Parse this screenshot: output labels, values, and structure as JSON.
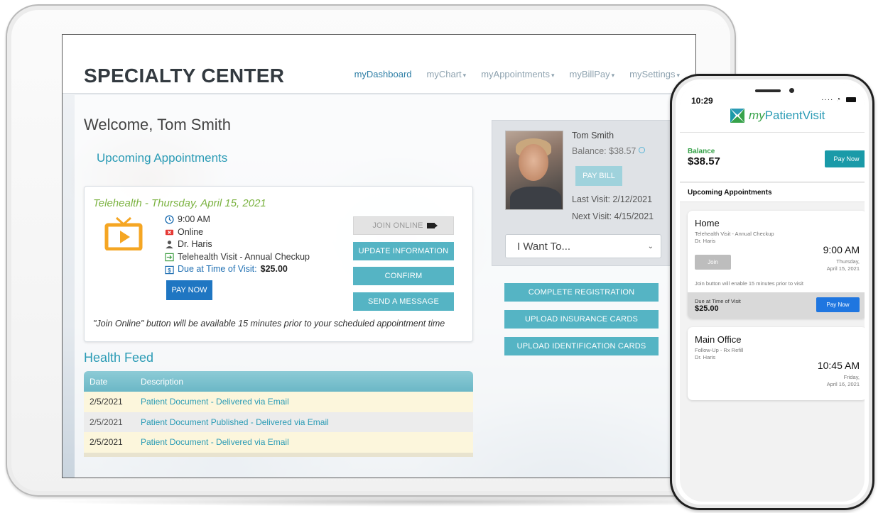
{
  "colors": {
    "accent": "#2a9bb5",
    "green": "#7cb342",
    "button": "#55b4c4",
    "pay_blue": "#1f76c2"
  },
  "site": {
    "title": "SPECIALTY CENTER",
    "nav": [
      {
        "prefix": "my",
        "label": "Dashboard"
      },
      {
        "prefix": "my",
        "label": "Chart"
      },
      {
        "prefix": "my",
        "label": "Appointments"
      },
      {
        "prefix": "my",
        "label": "BillPay"
      },
      {
        "prefix": "my",
        "label": "Settings"
      }
    ],
    "nav_full": [
      "myDashboard",
      "myChart",
      "myAppointments",
      "myBillPay",
      "mySettings"
    ]
  },
  "main": {
    "welcome": "Welcome, Tom Smith",
    "upcoming_title": "Upcoming Appointments",
    "appointment": {
      "heading": "Telehealth - Thursday, April 15, 2021",
      "time": "9:00 AM",
      "mode": "Online",
      "provider": "Dr. Haris",
      "visit_type": "Telehealth Visit - Annual Checkup",
      "due_label": "Due at Time of Visit:",
      "due_amount": "$25.00",
      "pay_now": "PAY NOW",
      "join_online": "JOIN ONLINE",
      "update_info": "UPDATE INFORMATION",
      "confirm": "CONFIRM",
      "send_message": "SEND A MESSAGE",
      "join_note": "\"Join Online\" button will be available 15 minutes prior to your scheduled appointment time",
      "icons": [
        "tv-icon",
        "clock-icon",
        "video-icon",
        "person-icon",
        "visit-arrow-icon",
        "dollar-icon",
        "camera-icon"
      ]
    },
    "health_feed": {
      "title": "Health Feed",
      "columns": [
        "Date",
        "Description"
      ],
      "rows": [
        {
          "date": "2/5/2021",
          "description": "Patient Document - Delivered via Email"
        },
        {
          "date": "2/5/2021",
          "description": "Patient Document Published - Delivered via Email"
        },
        {
          "date": "2/5/2021",
          "description": "Patient Document - Delivered via Email"
        }
      ]
    }
  },
  "profile": {
    "name": "Tom Smith",
    "balance": "Balance: $38.57",
    "pay_bill": "PAY BILL",
    "last_visit": "Last Visit: 2/12/2021",
    "next_visit": "Next Visit: 4/15/2021",
    "want_to": "I Want To..."
  },
  "actions": {
    "complete_registration": "COMPLETE REGISTRATION",
    "upload_insurance": "UPLOAD INSURANCE CARDS",
    "upload_identification": "UPLOAD IDENTIFICATION CARDS"
  },
  "phone": {
    "status_time": "10:29",
    "brand_prefix": "my",
    "brand_suffix": "PatientVisit",
    "balance_label": "Balance",
    "balance_value": "$38.57",
    "pay_now": "Pay Now",
    "upcoming": "Upcoming Appointments",
    "cards": [
      {
        "location": "Home",
        "subtitle": "Telehealth Visit - Annual Checkup",
        "provider": "Dr. Haris",
        "time": "9:00 AM",
        "day": "Thursday,",
        "date": "April 15, 2021",
        "join": "Join",
        "join_note": "Join button will enable 15 minutes prior to visit",
        "due_label": "Due at Time of Visit",
        "due_value": "$25.00",
        "pay_now": "Pay Now"
      },
      {
        "location": "Main Office",
        "subtitle": "Follow-Up - Rx Refill",
        "provider": "Dr. Haris",
        "time": "10:45 AM",
        "day": "Friday,",
        "date": "April 16, 2021"
      }
    ]
  }
}
